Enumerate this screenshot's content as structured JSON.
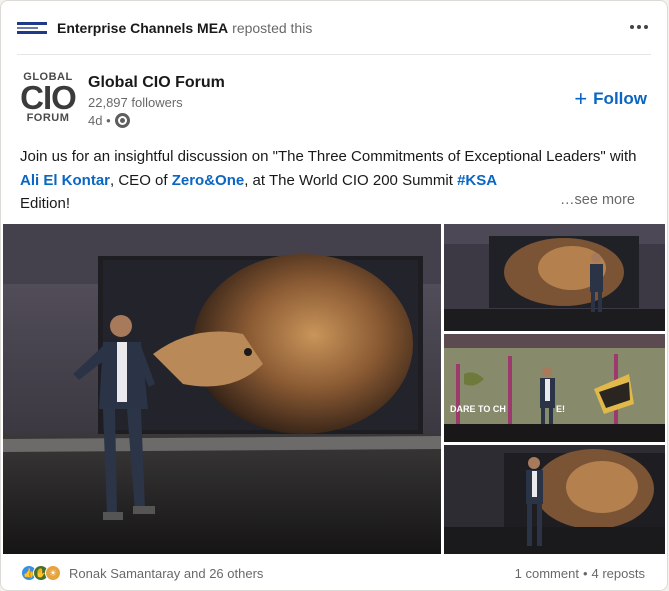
{
  "repost": {
    "actor": "Enterprise Channels MEA",
    "action": "reposted this",
    "logo_icon": "enterprise-channels-logo"
  },
  "author": {
    "logo_line1": "GLOBAL",
    "logo_line2": "CIO",
    "logo_line3": "FORUM",
    "name": "Global CIO Forum",
    "followers": "22,897 followers",
    "time": "4d •",
    "visibility_icon": "globe-icon"
  },
  "follow": {
    "plus": "+",
    "label": "Follow"
  },
  "post": {
    "p1": "Join us for an insightful discussion on \"The Three Commitments of Exceptional Leaders\" with ",
    "mention1": "Ali El Kontar",
    "p2": ", CEO of ",
    "mention2": "Zero&One",
    "p3": ", at The World CIO 200 Summit ",
    "hashtag": "#KSA",
    "p4": " Edition!",
    "see_more": "…see more"
  },
  "media": {
    "banner_text": "DARE TO CH",
    "banner_text2": "E!"
  },
  "footer": {
    "reactions_text": "Ronak Samantaray and 26 others",
    "comments": "1 comment",
    "separator": "•",
    "reposts": "4 reposts"
  },
  "colors": {
    "link": "#0a66c2",
    "like": "#378fe9",
    "celebrate": "#44712e",
    "insightful": "#e7a33e"
  }
}
